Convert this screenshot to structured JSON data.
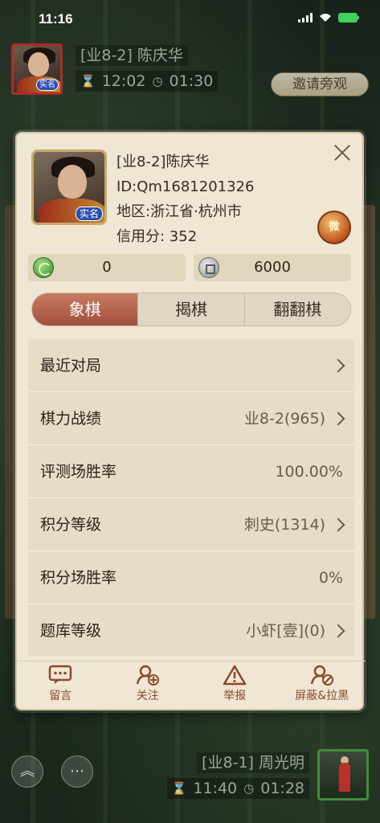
{
  "status_bar": {
    "time": "11:16"
  },
  "top_player": {
    "realname_tag": "实名",
    "name": "[业8-2] 陈庆华",
    "timer_total": "12:02",
    "timer_step": "01:30",
    "invite_label": "邀请旁观"
  },
  "profile": {
    "realname_tag": "实名",
    "name": "[业8-2]陈庆华",
    "id_text": "ID:Qm1681201326",
    "region_text": "地区:浙江省·杭州市",
    "credit_text": "信用分: 352",
    "rank_badge": "微"
  },
  "currency": {
    "green_coins": "0",
    "silver_coins": "6000"
  },
  "tabs": [
    {
      "label": "象棋",
      "active": true
    },
    {
      "label": "揭棋",
      "active": false
    },
    {
      "label": "翻翻棋",
      "active": false
    }
  ],
  "rows": [
    {
      "label": "最近对局",
      "value": "",
      "arrow": true
    },
    {
      "label": "棋力战绩",
      "value": "业8-2(965)",
      "arrow": true
    },
    {
      "label": "评测场胜率",
      "value": "100.00%",
      "arrow": false
    },
    {
      "label": "积分等级",
      "value": "刺史(1314)",
      "arrow": true
    },
    {
      "label": "积分场胜率",
      "value": "0%",
      "arrow": false
    },
    {
      "label": "题库等级",
      "value": "小虾[壹](0)",
      "arrow": true
    }
  ],
  "actions": [
    {
      "label": "留言",
      "icon": "message-icon"
    },
    {
      "label": "关注",
      "icon": "follow-icon"
    },
    {
      "label": "举报",
      "icon": "report-icon"
    },
    {
      "label": "屏蔽&拉黑",
      "icon": "block-icon"
    }
  ],
  "bottom_player": {
    "name": "[业8-1] 周光明",
    "timer_total": "11:40",
    "timer_step": "01:28"
  }
}
